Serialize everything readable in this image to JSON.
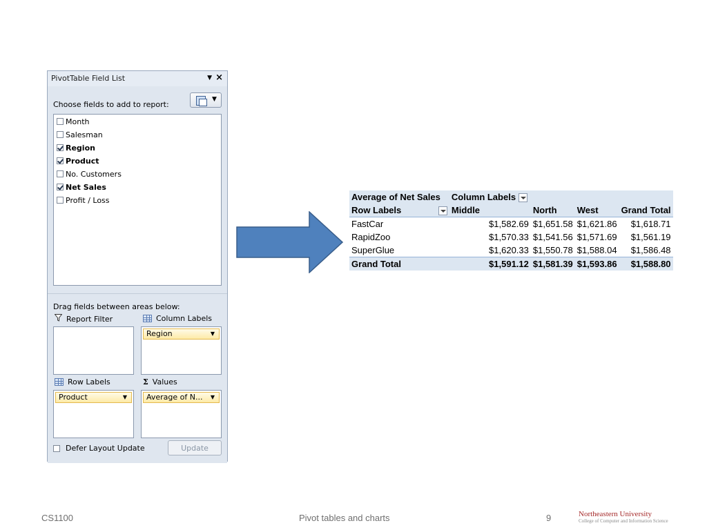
{
  "field_list": {
    "title": "PivotTable Field List",
    "choose_label": "Choose fields to add to report:",
    "fields": [
      {
        "label": "Month",
        "checked": false
      },
      {
        "label": "Salesman",
        "checked": false
      },
      {
        "label": "Region",
        "checked": true
      },
      {
        "label": "Product",
        "checked": true
      },
      {
        "label": "No. Customers",
        "checked": false
      },
      {
        "label": "Net Sales",
        "checked": true
      },
      {
        "label": "Profit / Loss",
        "checked": false
      }
    ],
    "drag_label": "Drag fields between areas below:",
    "areas": {
      "report_filter": {
        "label": "Report Filter"
      },
      "column_labels": {
        "label": "Column Labels",
        "chip": "Region"
      },
      "row_labels": {
        "label": "Row Labels",
        "chip": "Product"
      },
      "values": {
        "label": "Values",
        "chip": "Average of N..."
      }
    },
    "defer_label": "Defer Layout Update",
    "update_label": "Update"
  },
  "pivot": {
    "corner": "Average of Net Sales",
    "column_labels": "Column Labels",
    "row_labels": "Row Labels",
    "columns": [
      "Middle",
      "North",
      "West",
      "Grand Total"
    ],
    "rows": [
      {
        "label": "FastCar",
        "values": [
          "$1,582.69",
          "$1,651.58",
          "$1,621.86",
          "$1,618.71"
        ]
      },
      {
        "label": "RapidZoo",
        "values": [
          "$1,570.33",
          "$1,541.56",
          "$1,571.69",
          "$1,561.19"
        ]
      },
      {
        "label": "SuperGlue",
        "values": [
          "$1,620.33",
          "$1,550.78",
          "$1,588.04",
          "$1,586.48"
        ]
      }
    ],
    "total": {
      "label": "Grand Total",
      "values": [
        "$1,591.12",
        "$1,581.39",
        "$1,593.86",
        "$1,588.80"
      ]
    }
  },
  "footer": {
    "course": "CS1100",
    "topic": "Pivot tables and charts",
    "page": "9",
    "university": "Northeastern University",
    "college": "College of Computer and Information Science"
  },
  "colors": {
    "arrow": "#4f81bd",
    "header_fill": "#dce6f1"
  }
}
